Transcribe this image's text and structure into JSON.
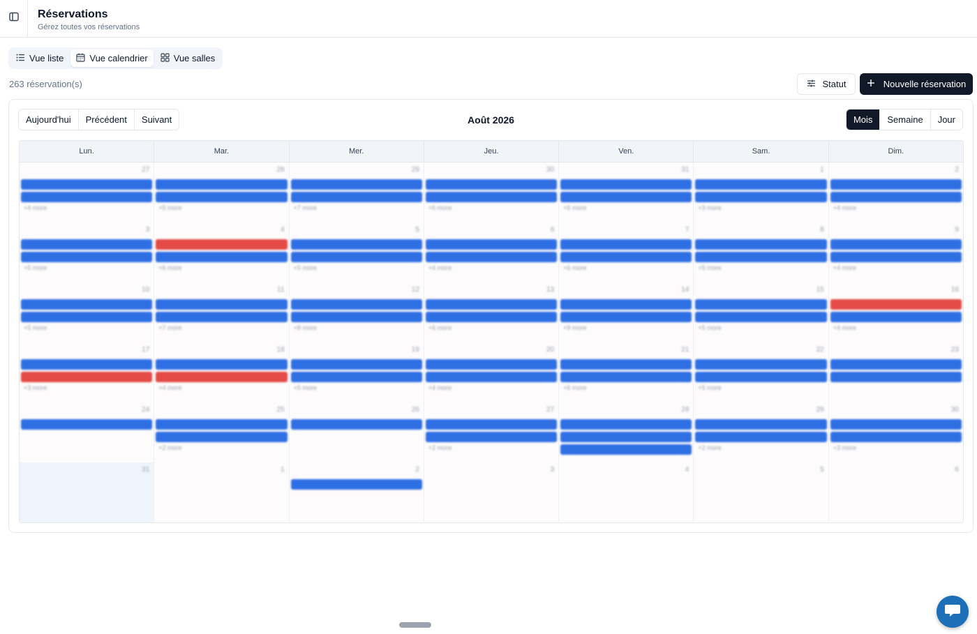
{
  "header": {
    "title": "Réservations",
    "subtitle": "Gérez toutes vos réservations"
  },
  "views": [
    {
      "label": "Vue liste",
      "icon": "list-icon",
      "active": false
    },
    {
      "label": "Vue calendrier",
      "icon": "calendar-icon",
      "active": true
    },
    {
      "label": "Vue salles",
      "icon": "grid-icon",
      "active": false
    }
  ],
  "toolbar": {
    "count_text": "263 réservation(s)",
    "status_label": "Statut",
    "new_label": "Nouvelle réservation"
  },
  "calendar": {
    "nav": {
      "today": "Aujourd'hui",
      "prev": "Précédent",
      "next": "Suivant"
    },
    "month_title": "Août 2026",
    "ranges": [
      {
        "label": "Mois",
        "active": true
      },
      {
        "label": "Semaine",
        "active": false
      },
      {
        "label": "Jour",
        "active": false
      }
    ],
    "weekdays": [
      "Lun.",
      "Mar.",
      "Mer.",
      "Jeu.",
      "Ven.",
      "Sam.",
      "Dim."
    ],
    "weeks": [
      [
        {
          "day": "27",
          "events": [
            "blue",
            "blue"
          ],
          "more": "+4 more"
        },
        {
          "day": "28",
          "events": [
            "blue",
            "blue"
          ],
          "more": "+5 more"
        },
        {
          "day": "29",
          "events": [
            "blue",
            "blue"
          ],
          "more": "+7 more"
        },
        {
          "day": "30",
          "events": [
            "blue",
            "blue"
          ],
          "more": "+6 more"
        },
        {
          "day": "31",
          "events": [
            "blue",
            "blue"
          ],
          "more": "+6 more"
        },
        {
          "day": "1",
          "events": [
            "blue",
            "blue"
          ],
          "more": "+3 more"
        },
        {
          "day": "2",
          "events": [
            "blue",
            "blue"
          ],
          "more": "+4 more"
        }
      ],
      [
        {
          "day": "3",
          "events": [
            "blue",
            "blue"
          ],
          "more": "+5 more"
        },
        {
          "day": "4",
          "events": [
            "red",
            "blue"
          ],
          "more": "+6 more"
        },
        {
          "day": "5",
          "events": [
            "blue",
            "blue"
          ],
          "more": "+5 more"
        },
        {
          "day": "6",
          "events": [
            "blue",
            "blue"
          ],
          "more": "+4 more"
        },
        {
          "day": "7",
          "events": [
            "blue",
            "blue"
          ],
          "more": "+6 more"
        },
        {
          "day": "8",
          "events": [
            "blue",
            "blue"
          ],
          "more": "+5 more"
        },
        {
          "day": "9",
          "events": [
            "blue",
            "blue"
          ],
          "more": "+4 more"
        }
      ],
      [
        {
          "day": "10",
          "events": [
            "blue",
            "blue"
          ],
          "more": "+5 more"
        },
        {
          "day": "11",
          "events": [
            "blue",
            "blue"
          ],
          "more": "+7 more"
        },
        {
          "day": "12",
          "events": [
            "blue",
            "blue"
          ],
          "more": "+8 more"
        },
        {
          "day": "13",
          "events": [
            "blue",
            "blue"
          ],
          "more": "+6 more"
        },
        {
          "day": "14",
          "events": [
            "blue",
            "blue"
          ],
          "more": "+9 more"
        },
        {
          "day": "15",
          "events": [
            "blue",
            "blue"
          ],
          "more": "+5 more"
        },
        {
          "day": "16",
          "events": [
            "red",
            "blue"
          ],
          "more": "+4 more"
        }
      ],
      [
        {
          "day": "17",
          "events": [
            "blue",
            "red"
          ],
          "more": "+3 more"
        },
        {
          "day": "18",
          "events": [
            "blue",
            "red"
          ],
          "more": "+4 more"
        },
        {
          "day": "19",
          "events": [
            "blue",
            "blue"
          ],
          "more": "+5 more"
        },
        {
          "day": "20",
          "events": [
            "blue",
            "blue"
          ],
          "more": "+4 more"
        },
        {
          "day": "21",
          "events": [
            "blue",
            "blue"
          ],
          "more": "+6 more"
        },
        {
          "day": "22",
          "events": [
            "blue",
            "blue"
          ],
          "more": "+5 more"
        },
        {
          "day": "23",
          "events": [
            "blue",
            "blue"
          ],
          "more": ""
        }
      ],
      [
        {
          "day": "24",
          "events": [
            "blue"
          ],
          "more": ""
        },
        {
          "day": "25",
          "events": [
            "blue",
            "blue"
          ],
          "more": "+2 more"
        },
        {
          "day": "26",
          "events": [
            "blue"
          ],
          "more": ""
        },
        {
          "day": "27",
          "events": [
            "blue",
            "blue"
          ],
          "more": "+2 more"
        },
        {
          "day": "28",
          "events": [
            "blue",
            "blue",
            "blue"
          ],
          "more": ""
        },
        {
          "day": "29",
          "events": [
            "blue",
            "blue"
          ],
          "more": "+2 more"
        },
        {
          "day": "30",
          "events": [
            "blue",
            "blue"
          ],
          "more": "+3 more"
        }
      ],
      [
        {
          "day": "31",
          "events": [],
          "more": "",
          "today": true
        },
        {
          "day": "1",
          "events": [],
          "more": ""
        },
        {
          "day": "2",
          "events": [
            "blue"
          ],
          "more": ""
        },
        {
          "day": "3",
          "events": [],
          "more": ""
        },
        {
          "day": "4",
          "events": [],
          "more": ""
        },
        {
          "day": "5",
          "events": [],
          "more": ""
        },
        {
          "day": "6",
          "events": [],
          "more": ""
        }
      ]
    ]
  },
  "colors": {
    "event_blue": "#2f6fe4",
    "event_red": "#e44a46",
    "primary_button": "#111827",
    "chat_bubble": "#1d6fb8"
  },
  "icons": {
    "sidebar_toggle": "sidebar-toggle-icon",
    "filter": "sliders-icon",
    "add": "plus-icon",
    "chat": "chat-icon"
  }
}
